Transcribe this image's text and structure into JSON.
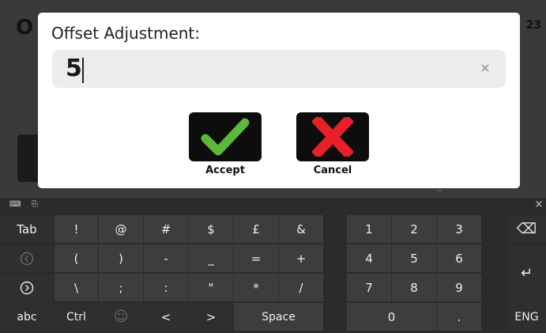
{
  "background": {
    "title_left": "O",
    "title_right": "23"
  },
  "dialog": {
    "title": "Offset Adjustment:",
    "input_value": "5",
    "clear_symbol": "×",
    "accept_label": "Accept",
    "cancel_label": "Cancel",
    "accent_green": "#5ab83a",
    "accent_red": "#e8202a"
  },
  "keyboard": {
    "row1": [
      "Tab",
      "!",
      "@",
      "#",
      "$",
      "£",
      "&",
      "1",
      "2",
      "3",
      "⌫"
    ],
    "row2": [
      "",
      "(",
      ")",
      "-",
      "_",
      "=",
      "+",
      "4",
      "5",
      "6",
      "↵"
    ],
    "row3": [
      "",
      "\\",
      ";",
      ":",
      "\"",
      "*",
      "/",
      "7",
      "8",
      "9"
    ],
    "row4": [
      "abc",
      "Ctrl",
      "☺",
      "<",
      ">",
      "Space",
      "0",
      ".",
      "ENG"
    ],
    "close_symbol": "×",
    "left_arrow_symbol": "‹",
    "right_arrow_symbol": "›"
  }
}
